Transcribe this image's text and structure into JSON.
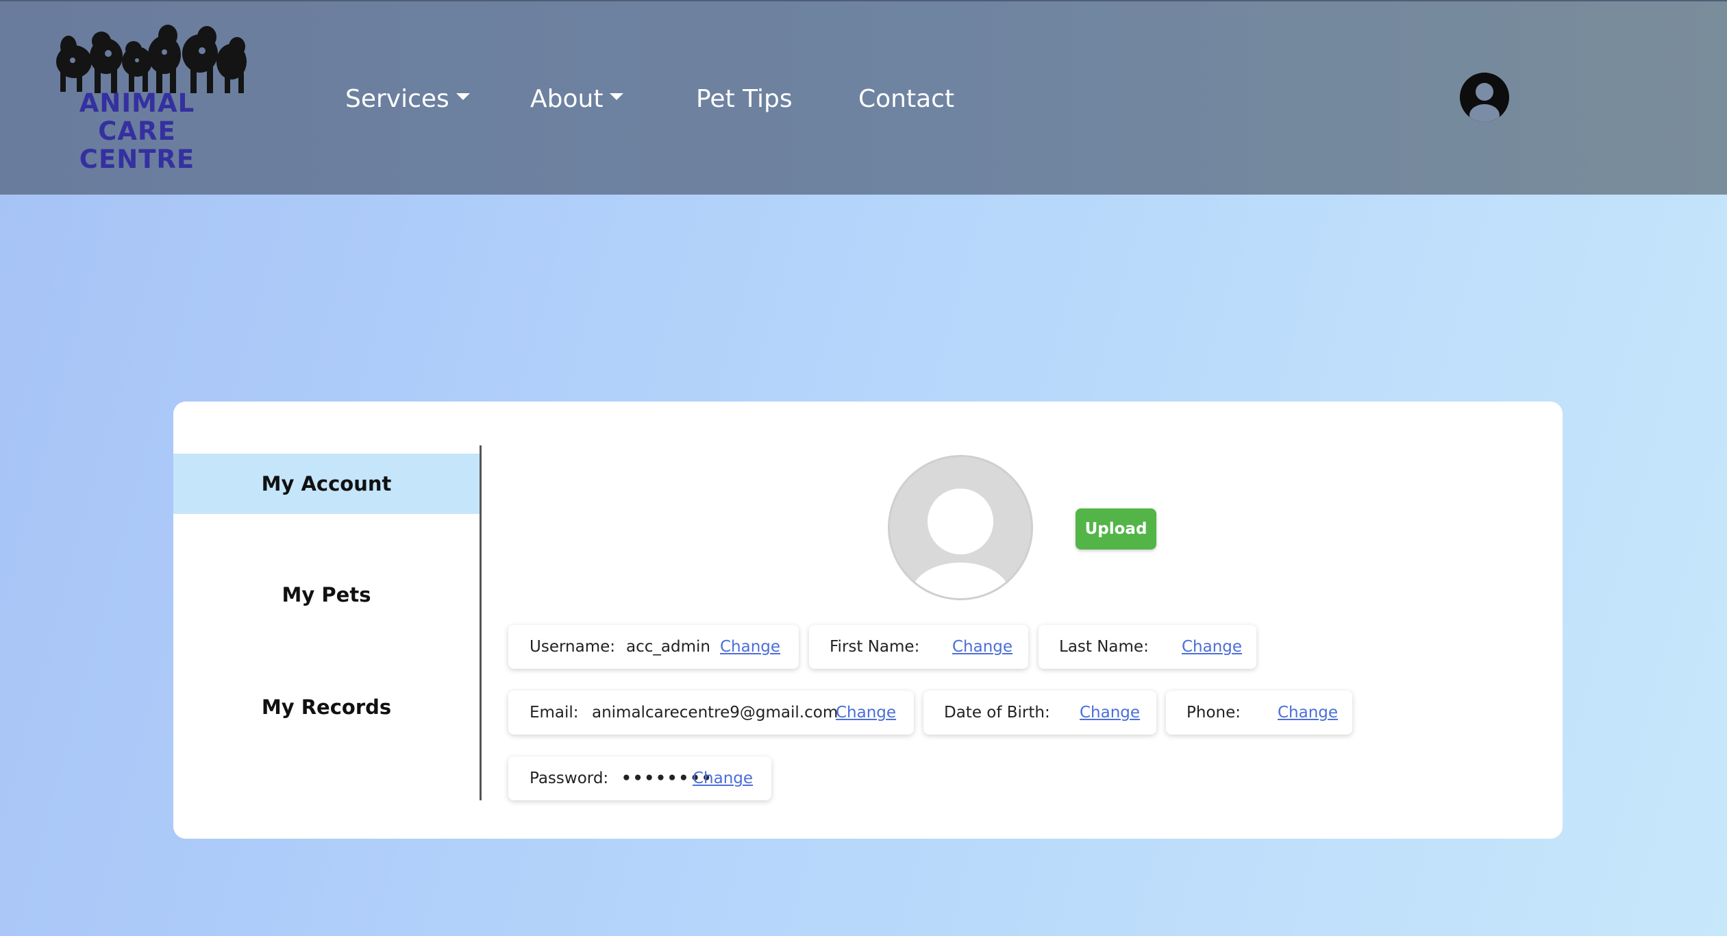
{
  "brand": {
    "logo_lines": [
      "ANIMAL",
      "CARE",
      "CENTRE"
    ],
    "logo_color": "#3530a0"
  },
  "nav": {
    "items": [
      {
        "label": "Services",
        "has_dropdown": true
      },
      {
        "label": "About",
        "has_dropdown": true
      },
      {
        "label": "Pet Tips",
        "has_dropdown": false
      },
      {
        "label": "Contact",
        "has_dropdown": false
      }
    ],
    "account_icon": "user-circle-icon"
  },
  "sidebar": {
    "items": [
      {
        "label": "My Account",
        "active": true
      },
      {
        "label": "My Pets",
        "active": false
      },
      {
        "label": "My Records",
        "active": false
      }
    ]
  },
  "profile": {
    "picture_icon": "user-silhouette-icon",
    "upload_label": "Upload",
    "upload_color": "#53b548"
  },
  "fields": {
    "username": {
      "label": "Username:",
      "value": "acc_admin",
      "action": "Change"
    },
    "first_name": {
      "label": "First Name:",
      "value": "",
      "action": "Change"
    },
    "last_name": {
      "label": "Last Name:",
      "value": "",
      "action": "Change"
    },
    "email": {
      "label": "Email:",
      "value": "animalcarecentre9@gmail.com",
      "action": "Change"
    },
    "dob": {
      "label": "Date of Birth:",
      "value": "",
      "action": "Change"
    },
    "phone": {
      "label": "Phone:",
      "value": "",
      "action": "Change"
    },
    "password": {
      "label": "Password:",
      "value": "••••••••",
      "action": "Change"
    }
  },
  "colors": {
    "link": "#4b6ed9",
    "active_tab": "#c5e5fb"
  }
}
